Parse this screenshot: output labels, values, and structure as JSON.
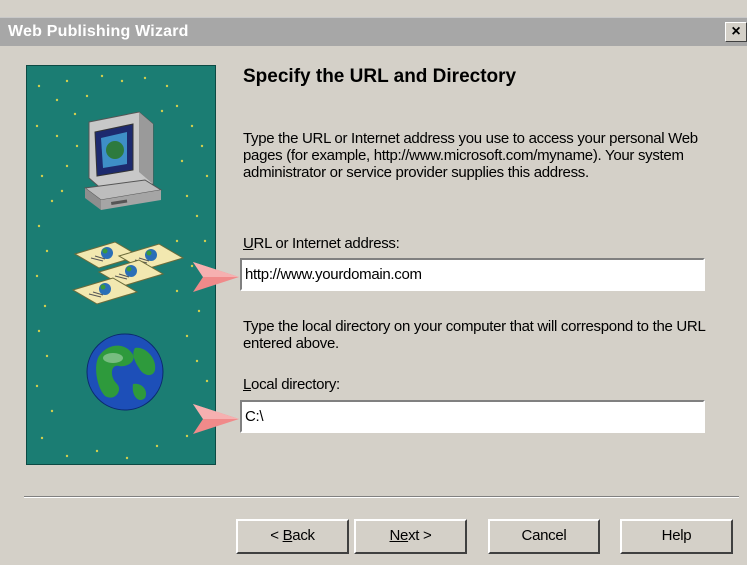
{
  "window": {
    "title": "Web Publishing Wizard",
    "close_glyph": "×"
  },
  "page": {
    "heading": "Specify the URL and Directory",
    "description_url": "Type the URL or Internet address you use to access your personal Web pages (for example, http://www.microsoft.com/myname). Your system administrator or service provider supplies this address.",
    "url_label_mnemonic": "U",
    "url_label_rest": "RL or Internet address:",
    "url_value": "http://www.yourdomain.com",
    "description_dir": "Type the local directory on your computer that will correspond to the URL entered above.",
    "dir_label_mnemonic": "L",
    "dir_label_rest": "ocal directory:",
    "dir_value": "C:\\"
  },
  "buttons": {
    "back_prefix": "< ",
    "back_mnemonic": "B",
    "back_rest": "ack",
    "next_mnemonic": "N",
    "next_middle": "e",
    "next_rest": "xt >",
    "cancel": "Cancel",
    "help": "Help"
  },
  "colors": {
    "titlebar": "#a7a7a7",
    "dialog": "#d4d0c8",
    "illustration_bg": "#1b7d73",
    "pointer_arrow": "#f08a8a"
  },
  "icons": {
    "illustration": "computer-web-pages-globe",
    "pointer": "pink-arrow-pointer"
  }
}
